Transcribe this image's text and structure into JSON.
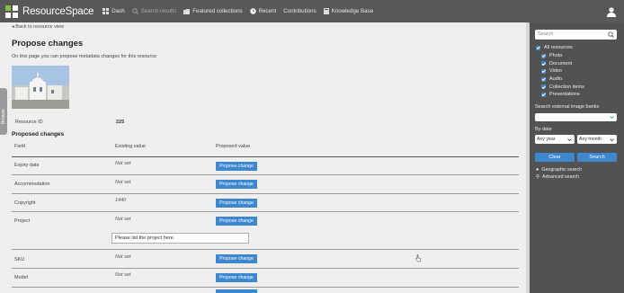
{
  "header": {
    "brand": "ResourceSpace",
    "nav": [
      {
        "label": "Dash",
        "icon": "grid-icon"
      },
      {
        "label": "Search results",
        "icon": "search-icon"
      },
      {
        "label": "Featured collections",
        "icon": "folder-icon"
      },
      {
        "label": "Recent",
        "icon": "clock-icon"
      },
      {
        "label": "Contributions",
        "icon": ""
      },
      {
        "label": "Knowledge Base",
        "icon": "book-icon"
      }
    ]
  },
  "main": {
    "back_link": "◂ Back to resource view",
    "title": "Propose changes",
    "intro": "On this page you can propose metadata changes for this resource",
    "browse_tab": "Browse",
    "resource_id_label": "Resource ID",
    "resource_id_value": "225",
    "section_title": "Proposed changes",
    "columns": [
      "Field",
      "Existing value",
      "Proposed value"
    ],
    "button_label": "Propose change",
    "rows": [
      {
        "field": "Expiry date",
        "existing": "Not set"
      },
      {
        "field": "Accommodation",
        "existing": "Not set"
      },
      {
        "field": "Copyright",
        "existing": "1440"
      },
      {
        "field": "Project",
        "existing": "Not set",
        "input_value": "Please list the project here."
      },
      {
        "field": "SKU",
        "existing": "Not set"
      },
      {
        "field": "Model",
        "existing": "Not set"
      }
    ]
  },
  "sidebar": {
    "search_placeholder": "Search",
    "all_resources": "All resources",
    "types": [
      "Photo",
      "Document",
      "Video",
      "Audio",
      "Collection items",
      "Presentations"
    ],
    "external_label": "Search external image banks",
    "by_date_label": "By date",
    "year_select": "Any year",
    "month_select": "Any month",
    "clear_label": "Clear",
    "search_label": "Search",
    "geo_link": "Geographic search",
    "advanced_link": "Advanced search"
  },
  "colors": {
    "header": "#585858",
    "sidebar": "#525252",
    "accent": "#3d87cf",
    "background": "#efefef"
  }
}
